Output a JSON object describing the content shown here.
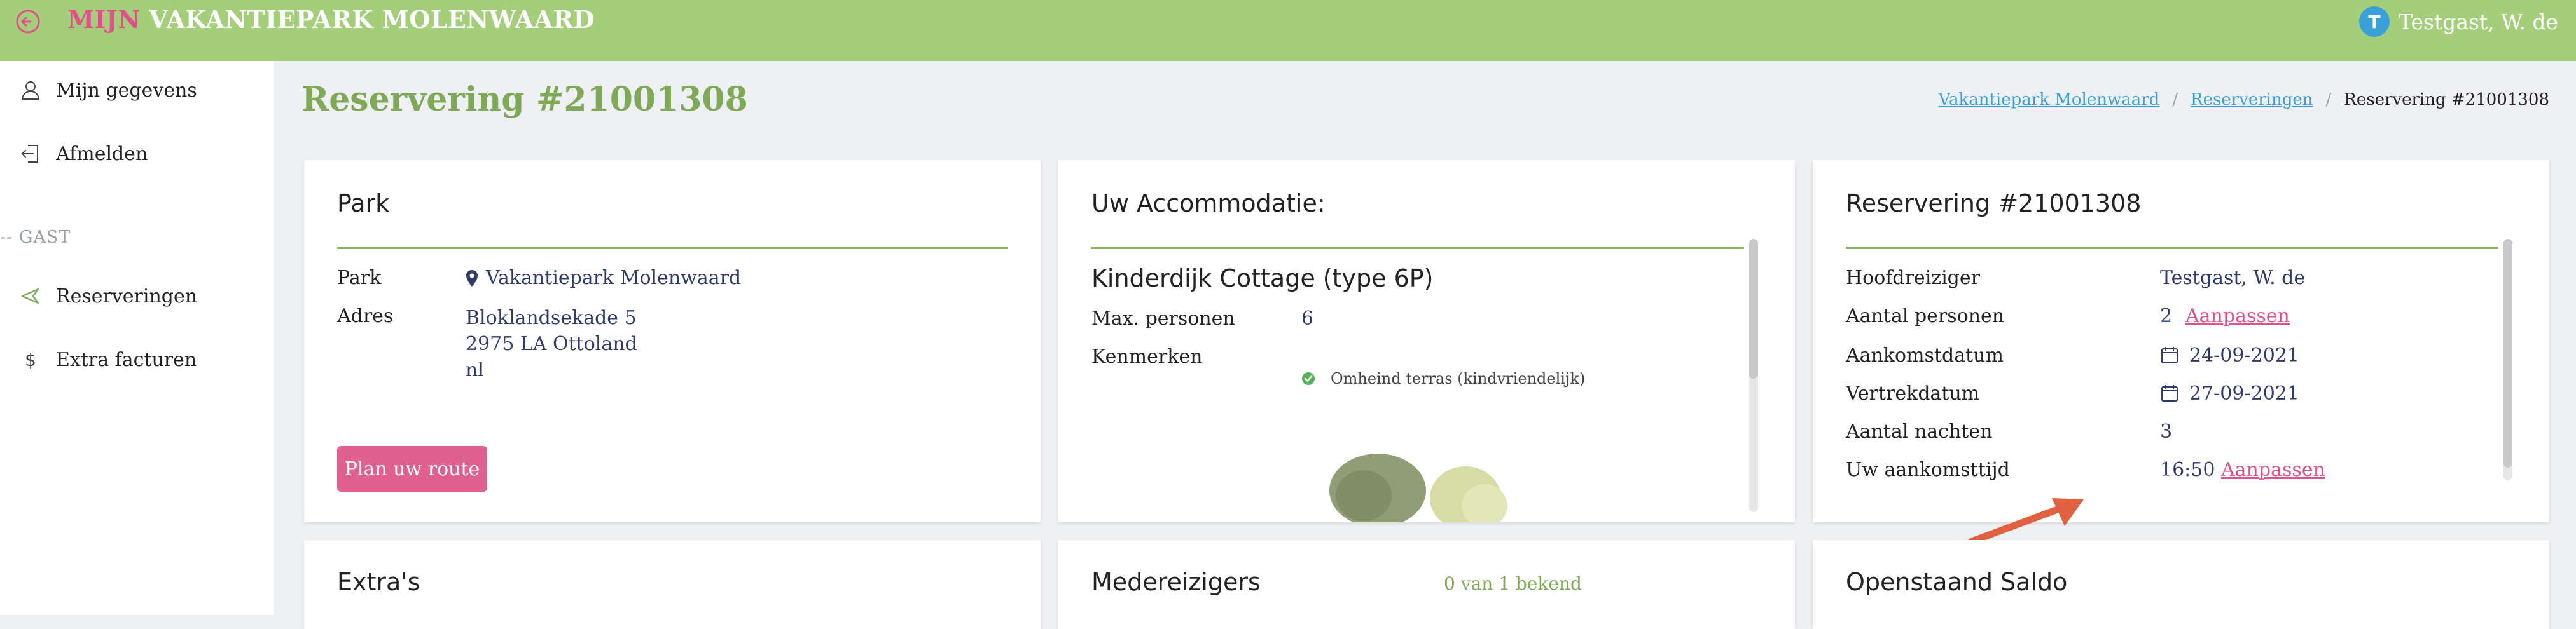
{
  "header": {
    "brand_prefix": "MIJN",
    "brand_name": "VAKANTIEPARK MOLENWAARD",
    "user_initial": "T",
    "user_name": "Testgast, W. de"
  },
  "sidebar": {
    "items": [
      {
        "label": "Mijn gegevens",
        "icon": "user-icon"
      },
      {
        "label": "Afmelden",
        "icon": "logout-icon"
      }
    ],
    "section_label": "-- GAST",
    "guest_items": [
      {
        "label": "Reserveringen",
        "icon": "send-icon"
      },
      {
        "label": "Extra facturen",
        "icon": "dollar-icon"
      }
    ]
  },
  "page": {
    "title": "Reservering #21001308",
    "breadcrumb": [
      "Vakantiepark Molenwaard",
      "Reserveringen",
      "Reservering #21001308"
    ]
  },
  "park_card": {
    "title": "Park",
    "park_label": "Park",
    "park_value": "Vakantiepark Molenwaard",
    "address_label": "Adres",
    "address_lines": [
      "Bloklandsekade 5",
      "2975 LA Ottoland",
      "nl"
    ],
    "route_button": "Plan uw route"
  },
  "accommodation_card": {
    "title": "Uw Accommodatie:",
    "name": "Kinderdijk Cottage (type 6P)",
    "max_persons_label": "Max. personen",
    "max_persons_value": "6",
    "features_label": "Kenmerken",
    "features": [
      "Omheind terras (kindvriendelijk)"
    ]
  },
  "reservation_card": {
    "title": "Reservering #21001308",
    "rows": [
      {
        "label": "Hoofdreiziger",
        "value": "Testgast, W. de"
      },
      {
        "label": "Aantal personen",
        "value": "2",
        "action": "Aanpassen"
      },
      {
        "label": "Aankomstdatum",
        "value": "24-09-2021",
        "icon": "calendar-icon"
      },
      {
        "label": "Vertrekdatum",
        "value": "27-09-2021",
        "icon": "calendar-icon"
      },
      {
        "label": "Aantal nachten",
        "value": "3"
      },
      {
        "label": "Uw aankomsttijd",
        "value": "16:50",
        "action": "Aanpassen"
      }
    ]
  },
  "bottom_cards": {
    "extras_title": "Extra's",
    "companions_title": "Medereizigers",
    "companions_status": "0 van 1 bekend",
    "balance_title": "Openstaand Saldo"
  },
  "colors": {
    "header_green": "#a5ce7b",
    "title_green": "#7fa957",
    "accent_pink": "#e0508a",
    "link_blue": "#3aa0d8",
    "annotation_arrow": "#e0603f"
  }
}
